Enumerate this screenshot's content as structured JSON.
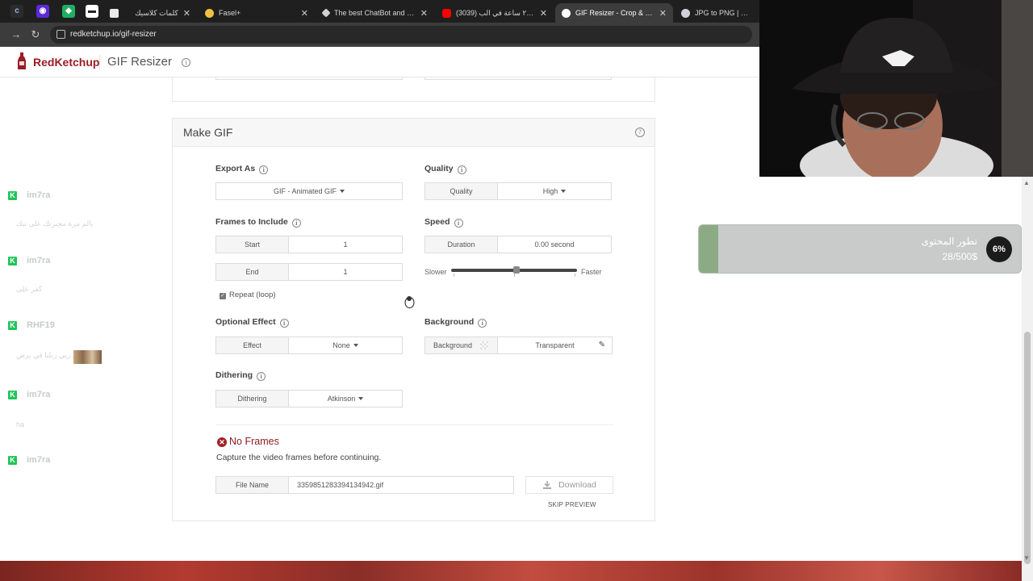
{
  "browser": {
    "tabs": [
      {
        "title": "كلمات كلاسيك",
        "favicon_color": "#e8eaed"
      },
      {
        "title": "Fasel+",
        "favicon_color": "#f3c142"
      },
      {
        "title": "The best ChatBot and Widg",
        "favicon_color": "#cfd2d6"
      },
      {
        "title": "(3039) جربت ٢٤ ساعة في الب",
        "favicon_color": "#ff0000"
      },
      {
        "title": "GIF Resizer - Crop & Resize",
        "favicon_color": "#ffffff"
      },
      {
        "title": "JPG to PNG | CloudCon",
        "favicon_color": "#cfd2d6"
      }
    ],
    "url": "redketchup.io/gif-resizer"
  },
  "site": {
    "brand": "RedKetchup",
    "tool_title": "GIF Resizer"
  },
  "make_gif": {
    "title": "Make GIF",
    "export_as": {
      "label": "Export As",
      "value": "GIF - Animated GIF"
    },
    "quality": {
      "label": "Quality",
      "key": "Quality",
      "value": "High"
    },
    "frames": {
      "label": "Frames to Include",
      "start_key": "Start",
      "start_value": "1",
      "end_key": "End",
      "end_value": "1"
    },
    "speed": {
      "label": "Speed",
      "key": "Duration",
      "value": "0.00 second",
      "slower": "Slower",
      "faster": "Faster",
      "level": 0.52
    },
    "repeat_label": "Repeat (loop)",
    "optional_effect": {
      "label": "Optional Effect",
      "key": "Effect",
      "value": "None"
    },
    "background": {
      "label": "Background",
      "key": "Background",
      "value": "Transparent"
    },
    "dithering": {
      "label": "Dithering",
      "key": "Dithering",
      "value": "Atkinson"
    },
    "status_title": "No Frames",
    "status_message": "Capture the video frames before continuing.",
    "file_name": {
      "key": "File Name",
      "value": "3359851283394134942.gif"
    },
    "download_label": "Download",
    "skip_preview_label": "SKIP PREVIEW"
  },
  "chat": [
    {
      "user": "im7ra",
      "message": "يالم مرة مجبرتك على نيك"
    },
    {
      "user": "im7ra",
      "message": "كفر على"
    },
    {
      "user": "RHF19",
      "message": "جيلال ربي زبلنا في يرض"
    },
    {
      "user": "im7ra",
      "message": "ha"
    },
    {
      "user": "im7ra",
      "message": ""
    }
  ],
  "widget": {
    "title": "تطور المحتوى",
    "amount": "28/500$",
    "percent_label": "6%",
    "progress": 0.06
  },
  "colors": {
    "brand": "#9b1c24",
    "chat_badge": "#1fc45a",
    "widget_fill": "#8cab84"
  }
}
